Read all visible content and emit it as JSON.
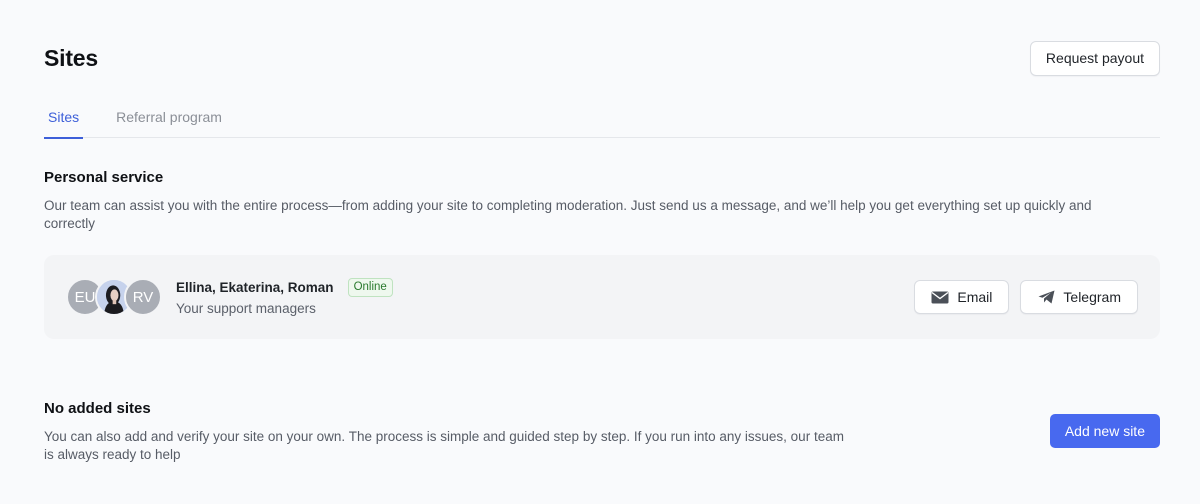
{
  "header": {
    "title": "Sites",
    "request_payout_label": "Request payout"
  },
  "tabs": [
    {
      "label": "Sites",
      "active": true
    },
    {
      "label": "Referral program",
      "active": false
    }
  ],
  "personal_service": {
    "title": "Personal service",
    "description": "Our team can assist you with the entire process—from adding your site to completing moderation. Just send us a message, and we’ll help you get everything set up quickly and correctly",
    "managers": {
      "avatars": [
        "EU",
        "",
        "RV"
      ],
      "names": "Ellina, Ekaterina, Roman",
      "status": "Online",
      "role": "Your support managers"
    },
    "actions": {
      "email_label": "Email",
      "email_icon": "envelope-icon",
      "telegram_label": "Telegram",
      "telegram_icon": "telegram-icon"
    }
  },
  "sites": {
    "title": "No added sites",
    "description": "You can also add and verify your site on your own. The process is simple and guided step by step. If you run into any issues, our team is always ready to help",
    "add_button_label": "Add new site"
  },
  "colors": {
    "accent": "#3d5fd9",
    "primary_button": "#4869ef",
    "online": "#2a7a2e",
    "background": "#f9fafc",
    "card": "#f3f4f6"
  }
}
